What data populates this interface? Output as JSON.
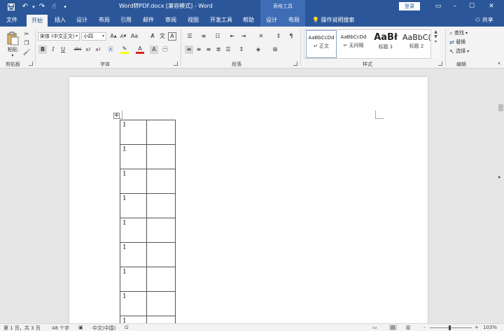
{
  "title_bar": {
    "document_title": "Word转PDF.docx [兼容模式] - Word",
    "table_tools": "表格工具",
    "login": "登录",
    "quick_access": {
      "save": "save-icon",
      "undo": "undo-icon",
      "redo": "redo-icon",
      "touch": "touch-mode-icon",
      "customize": "▾"
    }
  },
  "tabs": [
    {
      "label": "文件"
    },
    {
      "label": "开始"
    },
    {
      "label": "插入"
    },
    {
      "label": "设计"
    },
    {
      "label": "布局"
    },
    {
      "label": "引用"
    },
    {
      "label": "邮件"
    },
    {
      "label": "审阅"
    },
    {
      "label": "视图"
    },
    {
      "label": "开发工具"
    },
    {
      "label": "帮助"
    },
    {
      "label": "设计"
    },
    {
      "label": "布局"
    }
  ],
  "tell_me": "操作说明搜索",
  "share": "共享",
  "ribbon": {
    "clipboard": {
      "paste": "粘贴",
      "group": "剪贴板"
    },
    "font": {
      "font_name": "宋体 (中文正文)",
      "font_size": "小四",
      "group": "字体"
    },
    "paragraph": {
      "group": "段落"
    },
    "styles": {
      "items": [
        {
          "preview": "AaBbCcDd",
          "name": "↵ 正文"
        },
        {
          "preview": "AaBbCcDd",
          "name": "↵ 无间隔"
        },
        {
          "preview": "AaBł",
          "name": "标题 1"
        },
        {
          "preview": "AaBbC(",
          "name": "标题 2"
        }
      ],
      "group": "样式"
    },
    "editing": {
      "find": "查找",
      "replace": "替换",
      "select": "选择",
      "group": "编辑"
    }
  },
  "document": {
    "table_rows": [
      {
        "c1": "1",
        "c2": ""
      },
      {
        "c1": "1",
        "c2": ""
      },
      {
        "c1": "1",
        "c2": ""
      },
      {
        "c1": "1",
        "c2": ""
      },
      {
        "c1": "1",
        "c2": ""
      },
      {
        "c1": "1",
        "c2": ""
      },
      {
        "c1": "1",
        "c2": ""
      },
      {
        "c1": "1",
        "c2": ""
      },
      {
        "c1": "1",
        "c2": ""
      }
    ]
  },
  "status_bar": {
    "page": "第 1 页，共 3 页",
    "words": "48 个字",
    "language": "中文(中国)",
    "zoom_label": "103%",
    "zoom_minus": "-",
    "zoom_plus": "+"
  },
  "colors": {
    "brand": "#2b579a",
    "ribbon_bg": "#f3f3f3",
    "highlight": "#ffff00",
    "font_color": "#e02020"
  }
}
